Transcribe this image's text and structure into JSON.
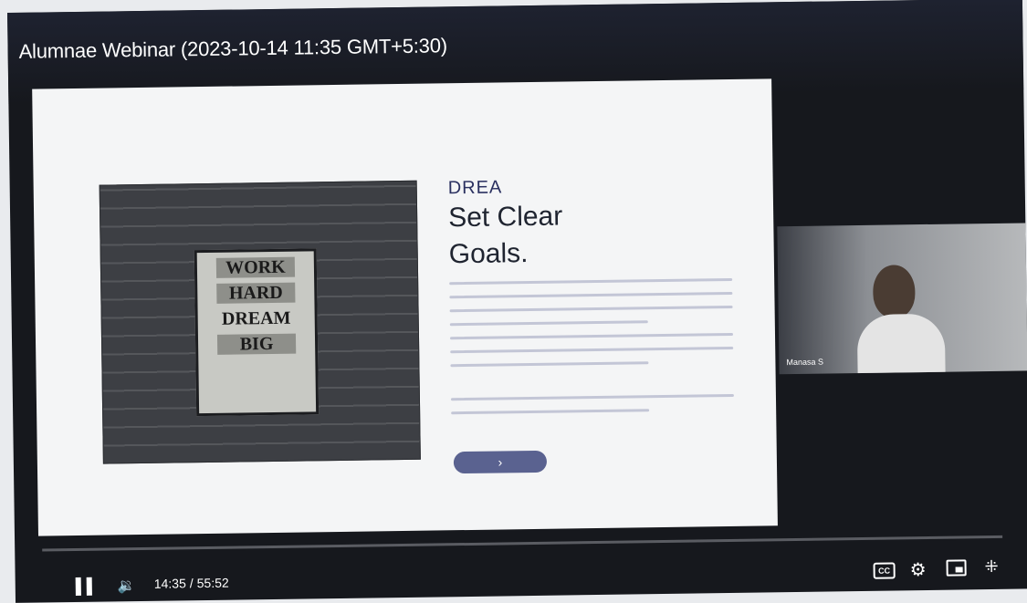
{
  "player": {
    "title": "Alumnae Webinar (2023-10-14 11:35 GMT+5:30)"
  },
  "slide": {
    "poster_words": [
      "WORK",
      "HARD",
      "DREAM",
      "BIG"
    ],
    "kicker": "DREA",
    "heading": "Set Clear Goals.",
    "button_label": "›"
  },
  "participant": {
    "name": "Manasa S"
  },
  "controls": {
    "current_time": "14:35",
    "separator": "/",
    "duration": "55:52",
    "pause_icon": "pause-icon",
    "volume_icon": "volume-icon",
    "captions_icon": "captions-icon",
    "captions_label": "CC",
    "settings_icon": "gear-icon",
    "miniplayer_icon": "miniplayer-icon",
    "fullscreen_exit_icon": "exit-fullscreen-icon",
    "volume_glyph": "🔉",
    "settings_glyph": "⚙",
    "exit_fullscreen_glyph": "⁜"
  },
  "colors": {
    "player_bg": "#16181d",
    "slide_bg": "#f4f5f6",
    "accent_button": "#5a6290"
  }
}
